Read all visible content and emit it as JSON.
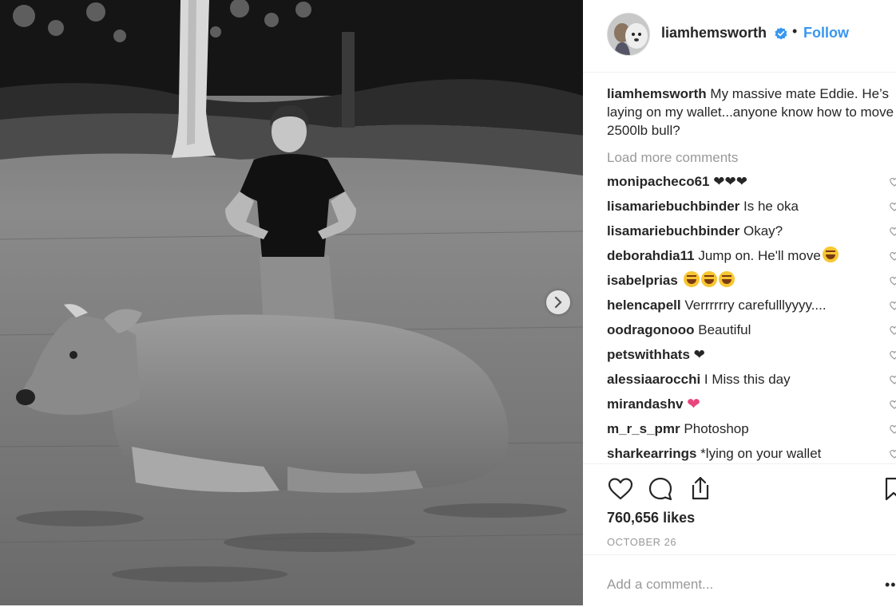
{
  "post": {
    "username": "liamhemsworth",
    "follow_label": "Follow",
    "separator": "•",
    "caption_user": "liamhemsworth",
    "caption_text": " My massive mate Eddie. He’s laying on my wallet...anyone know how to move a 2500lb bull?",
    "load_more": "Load more comments",
    "likes": "760,656 likes",
    "date": "OCTOBER 26",
    "add_comment_placeholder": "Add a comment...",
    "more_label": "••"
  },
  "comments": [
    {
      "user": "monipacheco61",
      "text": " ❤❤❤"
    },
    {
      "user": "lisamariebuchbinder",
      "text": " Is he oka"
    },
    {
      "user": "lisamariebuchbinder",
      "text": " Okay?"
    },
    {
      "user": "deborahdia11",
      "text": " Jump on. He'll move"
    },
    {
      "user": "isabelprias",
      "text": " "
    },
    {
      "user": "helencapell",
      "text": " Verrrrrry carefulllyyyy...."
    },
    {
      "user": "oodragonooo",
      "text": " Beautiful"
    },
    {
      "user": "petswithhats",
      "text": " ❤"
    },
    {
      "user": "alessiaarocchi",
      "text": " I Miss this day"
    },
    {
      "user": "mirandashv",
      "text": " "
    },
    {
      "user": "m_r_s_pmr",
      "text": " Photoshop"
    },
    {
      "user": "sharkearrings",
      "text": " *lying on your wallet"
    }
  ],
  "icons": {
    "verified": "verified-badge-icon",
    "like": "heart-icon",
    "comment": "comment-bubble-icon",
    "share": "share-icon",
    "save": "bookmark-icon",
    "next": "chevron-right-icon"
  },
  "colors": {
    "link_blue": "#3897f0",
    "muted_gray": "#999999",
    "text": "#262626"
  }
}
